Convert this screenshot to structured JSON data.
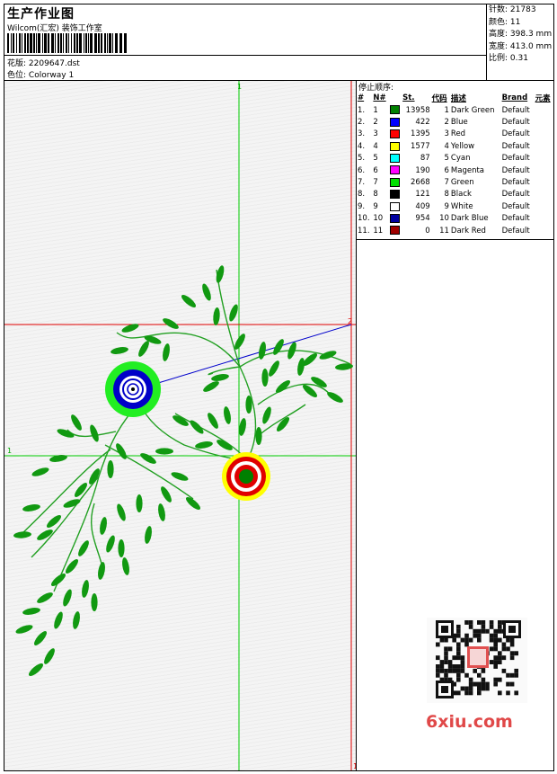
{
  "header": {
    "title": "生产作业图",
    "company": "Wilcom(汇宏) 装饰工作室",
    "design_label": "花版:",
    "design_value": "2209647.dst",
    "color_label": "色位:",
    "color_value": "Colorway 1"
  },
  "stats": [
    {
      "label": "针数:",
      "value": "21783"
    },
    {
      "label": "颜色:",
      "value": "11"
    },
    {
      "label": "高度:",
      "value": "398.3 mm"
    },
    {
      "label": "宽度:",
      "value": "413.0 mm"
    },
    {
      "label": "比例:",
      "value": "0.31"
    }
  ],
  "stops": {
    "title": "停止顺序:",
    "columns": [
      "#",
      "N#",
      "St.",
      "代码",
      "描述",
      "Brand",
      "元素"
    ],
    "rows": [
      {
        "idx": "1.",
        "n": "1",
        "st": "13958",
        "code": "1",
        "desc": "Dark Green",
        "brand": "Default",
        "color": "#008000"
      },
      {
        "idx": "2.",
        "n": "2",
        "st": "422",
        "code": "2",
        "desc": "Blue",
        "brand": "Default",
        "color": "#0000ff"
      },
      {
        "idx": "3.",
        "n": "3",
        "st": "1395",
        "code": "3",
        "desc": "Red",
        "brand": "Default",
        "color": "#ff0000"
      },
      {
        "idx": "4.",
        "n": "4",
        "st": "1577",
        "code": "4",
        "desc": "Yellow",
        "brand": "Default",
        "color": "#ffff00"
      },
      {
        "idx": "5.",
        "n": "5",
        "st": "87",
        "code": "5",
        "desc": "Cyan",
        "brand": "Default",
        "color": "#00ffff"
      },
      {
        "idx": "6.",
        "n": "6",
        "st": "190",
        "code": "6",
        "desc": "Magenta",
        "brand": "Default",
        "color": "#ff00ff"
      },
      {
        "idx": "7.",
        "n": "7",
        "st": "2668",
        "code": "7",
        "desc": "Green",
        "brand": "Default",
        "color": "#00e000"
      },
      {
        "idx": "8.",
        "n": "8",
        "st": "121",
        "code": "8",
        "desc": "Black",
        "brand": "Default",
        "color": "#000000"
      },
      {
        "idx": "9.",
        "n": "9",
        "st": "409",
        "code": "9",
        "desc": "White",
        "brand": "Default",
        "color": "#ffffff"
      },
      {
        "idx": "10.",
        "n": "10",
        "st": "954",
        "code": "10",
        "desc": "Dark Blue",
        "brand": "Default",
        "color": "#0000a0"
      },
      {
        "idx": "11.",
        "n": "11",
        "st": "0",
        "code": "11",
        "desc": "Dark Red",
        "brand": "Default",
        "color": "#a00000"
      }
    ]
  },
  "guides": {
    "v_top_label": "1",
    "h_red_label": "2",
    "h_green_label": "1",
    "bottom_label": "1"
  },
  "watermark": "6xiu.com",
  "colors": {
    "guide_green": "#00cc00",
    "guide_red": "#e00000",
    "leaf": "#119911",
    "stem": "#22a022",
    "link": "#0000cc"
  }
}
